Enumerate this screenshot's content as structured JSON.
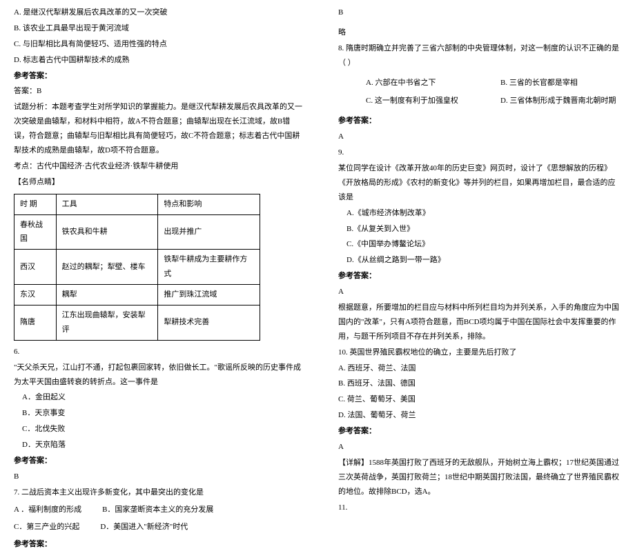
{
  "left": {
    "q5": {
      "optA": "A. 是继汉代犁耕发展后农具改革的又一次突破",
      "optB": "B. 该农业工具最早出现于黄河流域",
      "optC": "C. 与旧犁相比具有简便轻巧、适用性强的特点",
      "optD": "D. 标志着古代中国耕犁技术的成熟",
      "answerLabel": "参考答案：",
      "answerText": "答案：B",
      "analysis1": "试题分析：本题考查学生对所学知识的掌握能力。是继汉代犁耕发展后农具改革的又一次突破是曲辕犁，和材料中相符，故A不符合题意；曲辕犁出现在长江流域，故B错误，符合题意；曲辕犁与旧犁相比具有简便轻巧，故C不符合题意；标志着古代中国耕犁技术的成熟是曲辕犁，故D项不符合题意。",
      "analysis2": "考点：古代中国经济·古代农业经济·铁犁牛耕使用",
      "teacherNote": "【名师点睛】"
    },
    "table": {
      "r1c1": "时 期",
      "r1c2": "工具",
      "r1c3": "特点和影响",
      "r2c1": "春秋战国",
      "r2c2": "铁农具和牛耕",
      "r2c3": "出现并推广",
      "r3c1": "西汉",
      "r3c2": "赵过的耦犁；犁壁、楼车",
      "r3c3": "铁犁牛耕成为主要耕作方式",
      "r4c1": "东汉",
      "r4c2": "耦犁",
      "r4c3": "推广到珠江流域",
      "r5c1": "隋唐",
      "r5c2": "江东出现曲辕犁，安装犁评",
      "r5c3": "犁耕技术完善"
    },
    "q6": {
      "num": "6.",
      "stem1": "\"天父杀天兄，江山打不通，打起包裹回家转，依旧做长工。\"歌谣所反映的历史事件成为太平天国由盛转衰的转折点。这一事件是",
      "optA": "A．金田起义",
      "optB": "B．天京事变",
      "optC": "C．北伐失败",
      "optD": "D．天京陷落",
      "answerLabel": "参考答案：",
      "answer": "B"
    },
    "q7": {
      "num": "7.",
      "stem": " 二战后资本主义出现许多新变化，其中最突出的变化是",
      "optA": "A ．福利制度的形成",
      "optB": "B．国家垄断资本主义的充分发展",
      "optC": "C．第三产业的兴起",
      "optD": "D．美国进入\"新经济\"时代",
      "answerLabel": "参考答案："
    }
  },
  "right": {
    "q7ans": {
      "answer": "B",
      "note": "略"
    },
    "q8": {
      "stem": "8. 隋唐时期确立并完善了三省六部制的中央管理体制，对这一制度的认识不正确的是（  ）",
      "optA": "A. 六部在中书省之下",
      "optB": "B. 三省的长官都是宰相",
      "optC": "C. 这一制度有利于加强皇权",
      "optD": "D. 三省体制形成于魏晋南北朝时期",
      "answerLabel": "参考答案：",
      "answer": "A"
    },
    "q9": {
      "num": "9.",
      "stem": "某位同学在设计《改革开放40年的历史巨变》网页时，设计了《思想解放的历程》《开放格局的形成》《农村的新变化》等并列的栏目，如果再增加栏目，最合适的应该是",
      "optA": "A.《城市经济体制改革》",
      "optB": "B.《从复关到入世》",
      "optC": "C.《中国举办博鳌论坛》",
      "optD": "D.《从丝绸之路到一带一路》",
      "answerLabel": "参考答案：",
      "answer": "A",
      "analysis": "根据题意，所要增加的栏目应与材料中所列栏目均为并列关系，入手的角度应为中国国内的\"改革\"，只有A项符合题意，而BCD项均属于中国在国际社会中发挥重要的作用，与题干所列项目不存在并列关系，排除。"
    },
    "q10": {
      "stem": "10. 英国世界殖民霸权地位的确立，主要是先后打败了",
      "optA": "A. 西班牙、荷兰、法国",
      "optB": "B. 西班牙、法国、德国",
      "optC": "C. 荷兰、葡萄牙、美国",
      "optD": "D. 法国、葡萄牙、荷兰",
      "answerLabel": "参考答案：",
      "answer": "A",
      "detailLabel": "【详解】",
      "detail": "1588年英国打败了西班牙的无敌舰队，开始树立海上霸权；17世纪英国通过三次英荷战争，英国打败荷兰；18世纪中期英国打败法国，最终确立了世界殖民霸权的地位。故排除BCD，选A。"
    },
    "q11": {
      "num": "11."
    }
  }
}
